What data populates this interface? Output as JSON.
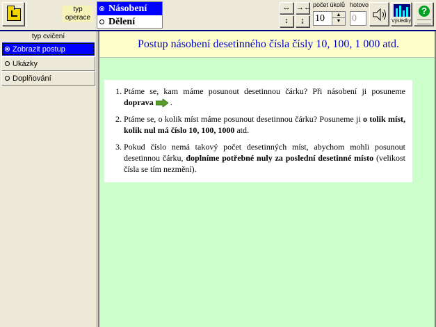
{
  "toolbar": {
    "operation_type_label": "typ operace",
    "operations": [
      {
        "label": "Násobení",
        "selected": true
      },
      {
        "label": "Dělení",
        "selected": false
      }
    ],
    "arrow_buttons": [
      "↔",
      "→←",
      "↕",
      "↨"
    ],
    "task_count_label": "počet úkolů",
    "task_count_value": "10",
    "done_label": "hotovo",
    "done_value": "0",
    "results_label": "Výsledky",
    "help_symbol": "?"
  },
  "sidebar": {
    "heading": "typ cvičení",
    "items": [
      {
        "label": "Zobrazit postup",
        "selected": true
      },
      {
        "label": "Ukázky",
        "selected": false
      },
      {
        "label": "Doplňování",
        "selected": false
      }
    ]
  },
  "main": {
    "title": "Postup násobení desetinného čísla čísly 10, 100, 1 000 atd.",
    "steps": [
      {
        "text_a": "Ptáme se, kam máme posunout desetinnou čárku? Při násobení ji posuneme ",
        "bold_a": "doprava",
        "text_b": " ."
      },
      {
        "text_a": "Ptáme se, o kolik míst máme posunout desetinnou čárku? Posuneme ji ",
        "bold_a": "o tolik míst, kolik nul má číslo 10, 100, 1000",
        "text_b": " atd."
      },
      {
        "text_a": "Pokud číslo nemá takový počet desetinných míst, abychom mohli posunout desetinnou čárku, ",
        "bold_a": "doplníme potřebné nuly za poslední desetinné místo",
        "text_b": " (velikost čísla se tím nezmění)."
      }
    ]
  },
  "colors": {
    "accent_blue": "#0000ff",
    "title_text": "#0000cc",
    "content_bg": "#ccffcc",
    "title_bg": "#ffffcc",
    "arrow_green": "#5a9e2a"
  }
}
